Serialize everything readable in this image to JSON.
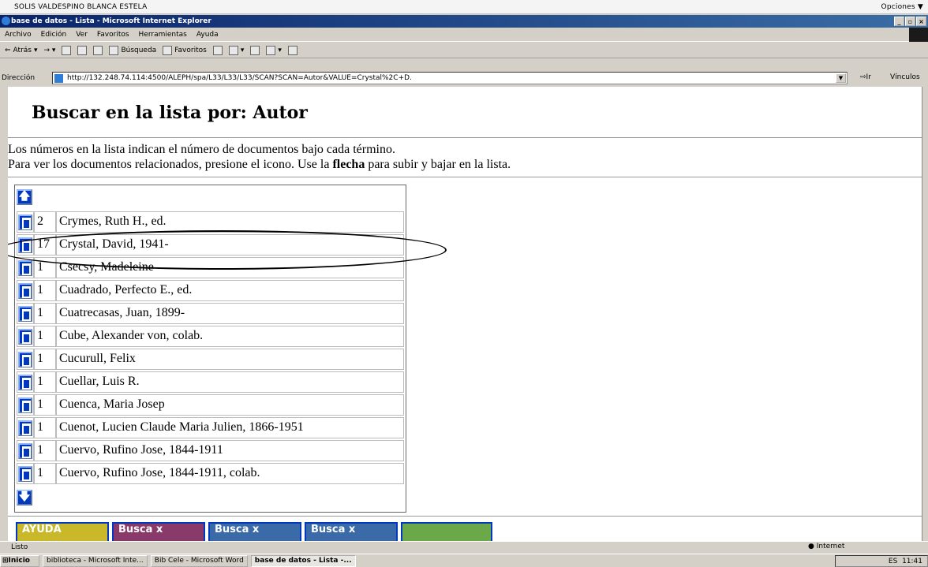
{
  "top_strip": {
    "user": "SOLIS VALDESPINO BLANCA ESTELA",
    "options": "Opciones ▼"
  },
  "window": {
    "title": "base de datos - Lista - Microsoft Internet Explorer"
  },
  "menu": [
    "Archivo",
    "Edición",
    "Ver",
    "Favoritos",
    "Herramientas",
    "Ayuda"
  ],
  "toolbar": {
    "back": "Atrás",
    "search": "Búsqueda",
    "favorites": "Favoritos"
  },
  "address": {
    "label": "Dirección",
    "url": "http://132.248.74.114:4500/ALEPH/spa/L33/L33/L33/SCAN?SCAN=Autor&VALUE=Crystal%2C+D.",
    "go": "Ir",
    "links": "Vínculos"
  },
  "page": {
    "heading": "Buscar en la lista por: Autor",
    "intro_line1": "Los números en la lista indican el número de documentos bajo cada término.",
    "intro_line2_pre": "Para ver los documentos relacionados, presione el icono. Use la ",
    "intro_line2_bold": "flecha",
    "intro_line2_post": " para subir y bajar en la lista."
  },
  "list": [
    {
      "count": "2",
      "name": "Crymes, Ruth H., ed."
    },
    {
      "count": "17",
      "name": "Crystal, David, 1941-"
    },
    {
      "count": "1",
      "name": "Csecsy, Madeleine"
    },
    {
      "count": "1",
      "name": "Cuadrado, Perfecto E., ed."
    },
    {
      "count": "1",
      "name": "Cuatrecasas, Juan, 1899-"
    },
    {
      "count": "1",
      "name": "Cube, Alexander von, colab."
    },
    {
      "count": "1",
      "name": "Cucurull, Felix"
    },
    {
      "count": "1",
      "name": "Cuellar, Luis R."
    },
    {
      "count": "1",
      "name": "Cuenca, Maria Josep"
    },
    {
      "count": "1",
      "name": "Cuenot, Lucien Claude Maria Julien, 1866-1951"
    },
    {
      "count": "1",
      "name": "Cuervo, Rufino Jose, 1844-1911"
    },
    {
      "count": "1",
      "name": "Cuervo, Rufino Jose, 1844-1911, colab."
    }
  ],
  "bottom_buttons": [
    "AYUDA",
    "Busca x",
    "Busca x",
    "Busca x"
  ],
  "status": {
    "text": "Listo",
    "zone": "Internet"
  },
  "taskbar": {
    "start": "Inicio",
    "tasks": [
      "biblioteca - Microsoft Inte...",
      "Bib Cele - Microsoft Word",
      "base de datos - Lista -..."
    ],
    "lang": "ES",
    "clock": "11:41"
  }
}
